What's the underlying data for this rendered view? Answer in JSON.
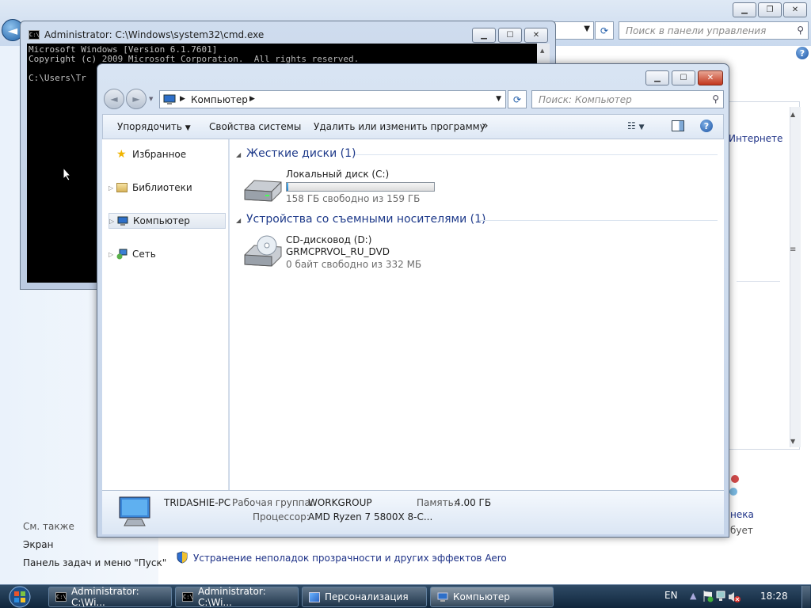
{
  "control_panel": {
    "search_placeholder": "Поиск в панели управления",
    "right_link": "Интернете",
    "see_also": "См. также",
    "links": [
      "Экран",
      "Панель задач и меню \"Пуск\""
    ],
    "aero_link": "Устранение неполадок прозрачности и других эффектов Aero",
    "right_fragment_1": "нека",
    "right_fragment_2": "бует"
  },
  "cmd": {
    "title": "Administrator: C:\\Windows\\system32\\cmd.exe",
    "lines": [
      "Microsoft Windows [Version 6.1.7601]",
      "Copyright (c) 2009 Microsoft Corporation.  All rights reserved.",
      "",
      "C:\\Users\\Tr"
    ]
  },
  "explorer": {
    "breadcrumb": "Компьютер",
    "search_placeholder": "Поиск: Компьютер",
    "toolbar": {
      "organize": "Упорядочить",
      "system_properties": "Свойства системы",
      "uninstall": "Удалить или изменить программу",
      "more": "»"
    },
    "nav": [
      "Избранное",
      "Библиотеки",
      "Компьютер",
      "Сеть"
    ],
    "groups": [
      {
        "title": "Жесткие диски (1)",
        "items": [
          {
            "name": "Локальный диск (C:)",
            "free_text": "158 ГБ свободно из 159 ГБ",
            "used_fraction": 0.01
          }
        ]
      },
      {
        "title": "Устройства со съемными носителями (1)",
        "items": [
          {
            "name": "CD-дисковод (D:)",
            "label": "GRMCPRVOL_RU_DVD",
            "free_text": "0 байт свободно из 332 МБ"
          }
        ]
      }
    ],
    "details": {
      "pc_name": "TRIDASHIE-PC",
      "workgroup_label": "Рабочая группа:",
      "workgroup_value": "WORKGROUP",
      "memory_label": "Память:",
      "memory_value": "4.00 ГБ",
      "cpu_label": "Процессор:",
      "cpu_value": "AMD Ryzen 7 5800X 8-C..."
    }
  },
  "taskbar": {
    "tasks": [
      "Administrator: C:\\Wi...",
      "Administrator: C:\\Wi...",
      "Персонализация",
      "Компьютер"
    ],
    "language": "EN",
    "time": "18:28"
  },
  "colors": {
    "link": "#1e3287",
    "group_heading": "#1e3a8a",
    "taskbar": "#1b3550"
  }
}
